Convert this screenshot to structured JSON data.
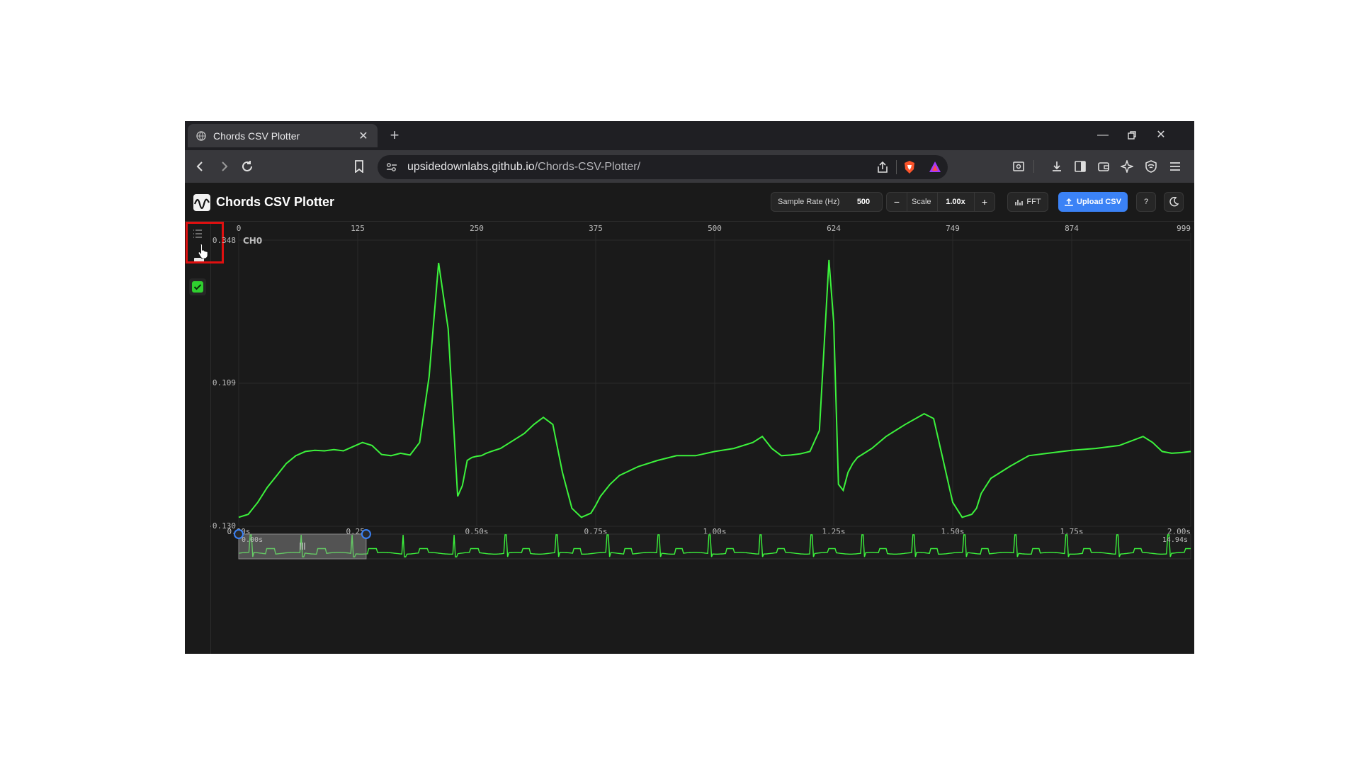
{
  "browser": {
    "tab_title": "Chords CSV Plotter",
    "new_tab_label": "+",
    "url_domain": "upsidedownlabs.github.io",
    "url_path": "/Chords-CSV-Plotter/"
  },
  "app": {
    "name": "Chords CSV Plotter",
    "sample_rate_label": "Sample Rate (Hz)",
    "sample_rate_value": "500",
    "scale_label": "Scale",
    "scale_value": "1.00x",
    "minus_label": "−",
    "plus_label": "+",
    "fft_label": "FFT",
    "upload_label": "Upload CSV",
    "help_label": "?",
    "channel_enabled": true
  },
  "colors": {
    "signal": "#3cf33c",
    "accent": "#3b82f6",
    "highlight_box": "#e01010"
  },
  "chart_data": {
    "type": "line",
    "title": "",
    "series": [
      {
        "name": "CH0",
        "x": [
          0,
          0.02,
          0.04,
          0.06,
          0.08,
          0.1,
          0.12,
          0.14,
          0.16,
          0.18,
          0.2,
          0.22,
          0.24,
          0.26,
          0.28,
          0.3,
          0.32,
          0.34,
          0.36,
          0.38,
          0.4,
          0.42,
          0.44,
          0.46,
          0.47,
          0.48,
          0.49,
          0.5,
          0.51,
          0.52,
          0.53,
          0.55,
          0.57,
          0.6,
          0.62,
          0.64,
          0.66,
          0.68,
          0.7,
          0.72,
          0.74,
          0.75,
          0.76,
          0.78,
          0.8,
          0.84,
          0.88,
          0.92,
          0.96,
          1.0,
          1.04,
          1.08,
          1.1,
          1.12,
          1.14,
          1.16,
          1.18,
          1.2,
          1.22,
          1.24,
          1.25,
          1.26,
          1.27,
          1.28,
          1.29,
          1.3,
          1.31,
          1.33,
          1.36,
          1.4,
          1.44,
          1.46,
          1.48,
          1.5,
          1.52,
          1.54,
          1.55,
          1.56,
          1.58,
          1.62,
          1.66,
          1.7,
          1.75,
          1.8,
          1.85,
          1.9,
          1.92,
          1.94,
          1.96,
          1.98,
          2.0
        ],
        "y": [
          -0.115,
          -0.11,
          -0.09,
          -0.065,
          -0.045,
          -0.025,
          -0.012,
          -0.005,
          -0.003,
          -0.004,
          -0.002,
          -0.004,
          0.003,
          0.01,
          0.005,
          -0.01,
          -0.012,
          -0.008,
          -0.011,
          0.01,
          0.12,
          0.31,
          0.2,
          -0.08,
          -0.062,
          -0.02,
          -0.015,
          -0.013,
          -0.012,
          -0.008,
          -0.005,
          0.0,
          0.01,
          0.025,
          0.04,
          0.052,
          0.04,
          -0.04,
          -0.1,
          -0.115,
          -0.108,
          -0.095,
          -0.08,
          -0.06,
          -0.045,
          -0.03,
          -0.02,
          -0.012,
          -0.012,
          -0.005,
          0.0,
          0.01,
          0.02,
          0.0,
          -0.012,
          -0.011,
          -0.009,
          -0.005,
          0.03,
          0.315,
          0.21,
          -0.06,
          -0.07,
          -0.04,
          -0.025,
          -0.015,
          -0.01,
          0.0,
          0.02,
          0.04,
          0.058,
          0.05,
          -0.02,
          -0.09,
          -0.115,
          -0.11,
          -0.1,
          -0.075,
          -0.05,
          -0.03,
          -0.012,
          -0.008,
          -0.003,
          0.0,
          0.005,
          0.02,
          0.01,
          -0.005,
          -0.008,
          -0.007,
          -0.005
        ]
      }
    ],
    "x_ticks": [
      "0.00s",
      "0.25s",
      "0.50s",
      "0.75s",
      "1.00s",
      "1.25s",
      "1.50s",
      "1.75s",
      "2.00s"
    ],
    "top_ticks": [
      "0",
      "125",
      "250",
      "375",
      "500",
      "624",
      "749",
      "874",
      "999"
    ],
    "y_ticks": [
      "0.348",
      "0.109",
      "-0.130"
    ],
    "xlim": [
      0,
      2.0
    ],
    "ylim": [
      -0.13,
      0.348
    ],
    "grid": true,
    "overview": {
      "start_label": "0.00s",
      "end_label": "14.94s",
      "window": [
        0,
        2.0
      ],
      "total": 14.94
    }
  }
}
